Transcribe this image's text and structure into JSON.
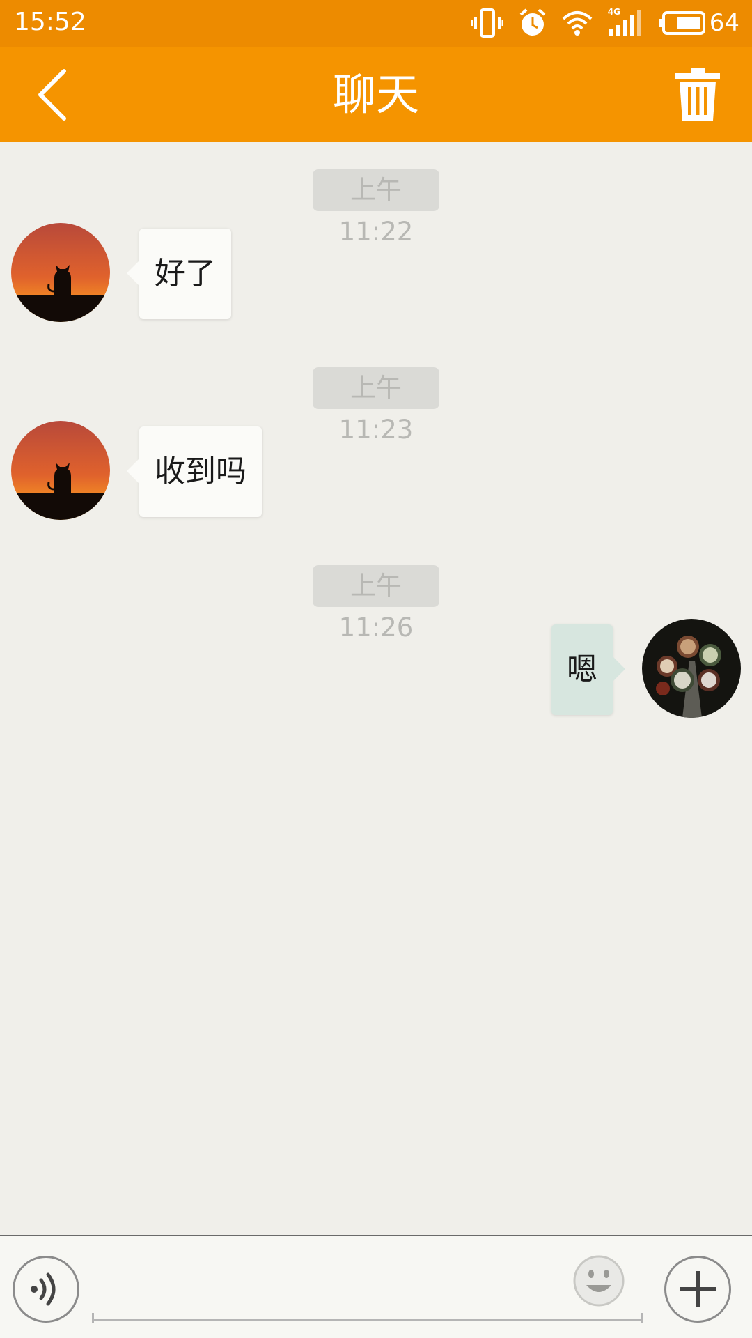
{
  "status_bar": {
    "time": "15:52",
    "battery_percent": "64",
    "network_label": "4G",
    "icons": [
      "vibrate-icon",
      "alarm-icon",
      "wifi-icon",
      "signal-icon",
      "battery-icon"
    ]
  },
  "header": {
    "title": "聊天",
    "back_icon": "chevron-left-icon",
    "delete_icon": "trash-icon"
  },
  "colors": {
    "status_bar": "#ed8b00",
    "app_bar": "#f59400",
    "chat_bg": "#f0efea",
    "bubble_incoming": "#fbfbf8",
    "bubble_outgoing": "#d7e6df",
    "time_pill": "#dadad6"
  },
  "messages": [
    {
      "timestamp": "上午 11:22",
      "direction": "incoming",
      "text": "好了",
      "avatar": "cat-sunset-avatar"
    },
    {
      "timestamp": "上午 11:23",
      "direction": "incoming",
      "text": "收到吗",
      "avatar": "cat-sunset-avatar"
    },
    {
      "timestamp": "上午 11:26",
      "direction": "outgoing",
      "text": "嗯",
      "avatar": "coffee-cups-avatar"
    }
  ],
  "input_bar": {
    "value": "",
    "voice_icon": "voice-icon",
    "emoji_icon": "emoji-icon",
    "plus_icon": "plus-icon"
  }
}
